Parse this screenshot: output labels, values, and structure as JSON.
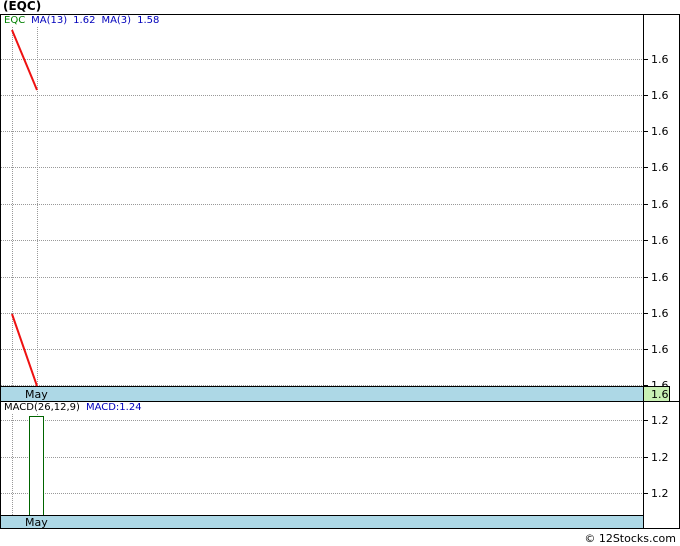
{
  "title": "(EQC)",
  "legend": {
    "symbol": "EQC",
    "ma13_label": "MA(13)",
    "ma13_value": "1.62",
    "ma3_label": "MA(3)",
    "ma3_value": "1.58",
    "macd_label": "MACD(26,12,9)",
    "macd_value": "MACD:1.24"
  },
  "footer": "© 12Stocks.com",
  "colors": {
    "price_line": "#ee1111",
    "axis_band": "#add8e6",
    "last_price_box": "#c8f0b4",
    "macd_bar": "#006400",
    "grid": "#999999"
  },
  "chart_data": [
    {
      "type": "line",
      "name": "price",
      "x_tick_labels": [
        "May"
      ],
      "y_tick_labels": [
        "1.6",
        "1.6",
        "1.6",
        "1.6",
        "1.6",
        "1.6",
        "1.6",
        "1.6",
        "1.6",
        "1.6"
      ],
      "last_price_label": "1.6",
      "series": [
        {
          "name": "EQC",
          "values": [
            1.62,
            1.58
          ]
        },
        {
          "name": "MA(3)",
          "values": [
            1.62,
            1.58
          ]
        }
      ]
    },
    {
      "type": "bar",
      "name": "macd",
      "x_tick_labels": [
        "May"
      ],
      "y_tick_labels": [
        "1.2",
        "1.2",
        "1.2"
      ],
      "series": [
        {
          "name": "MACD",
          "values": [
            1.24
          ]
        }
      ]
    }
  ]
}
